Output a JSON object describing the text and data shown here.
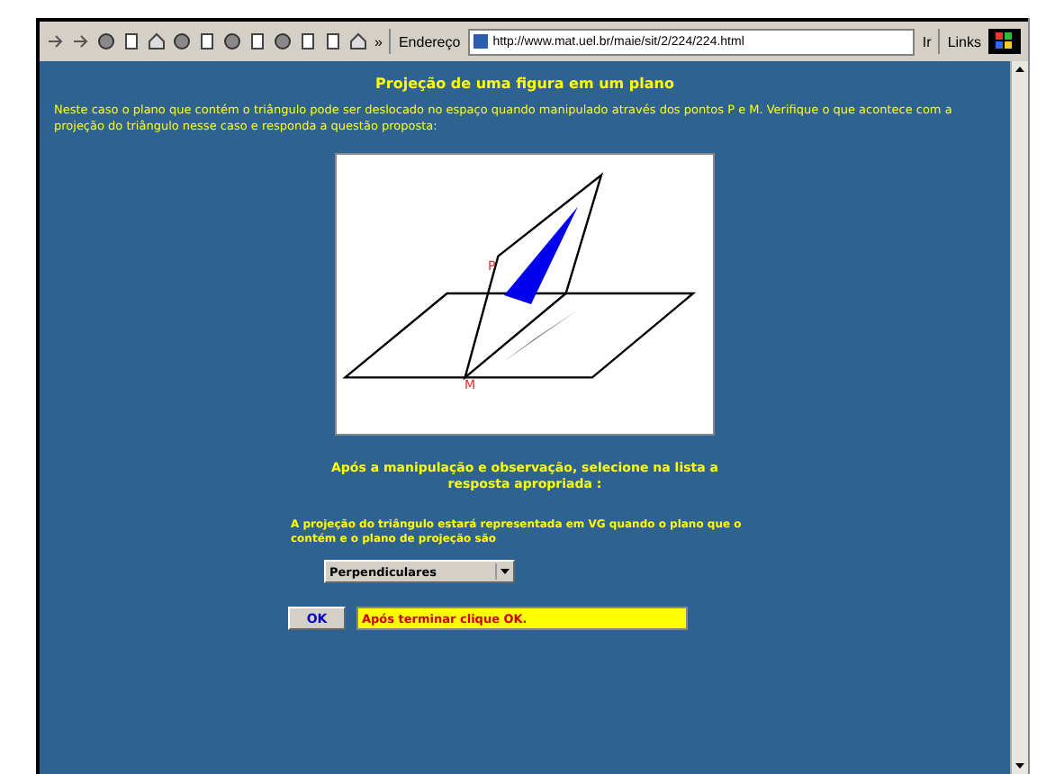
{
  "toolbar": {
    "address_label": "Endereço",
    "url": "http://www.mat.uel.br/maie/sit/2/224/224.html",
    "go": "Ir",
    "links": "Links",
    "more": "»"
  },
  "page": {
    "title": "Projeção de uma figura em um plano",
    "intro": "Neste caso o plano que contém o triângulo pode ser deslocado no espaço quando manipulado através dos pontos P e M. Verifique o que acontece com a projeção do triângulo nesse caso e responda a questão proposta:",
    "figure": {
      "labels": [
        "P",
        "M"
      ]
    },
    "instruction": "Após a manipulação e observação, selecione na lista a resposta apropriada :",
    "question": "A projeção do triângulo estará representada em VG quando o plano que o contém e o plano de projeção são",
    "answer": {
      "value": "Perpendiculares"
    },
    "ok": "OK",
    "status": "Após terminar clique OK."
  }
}
